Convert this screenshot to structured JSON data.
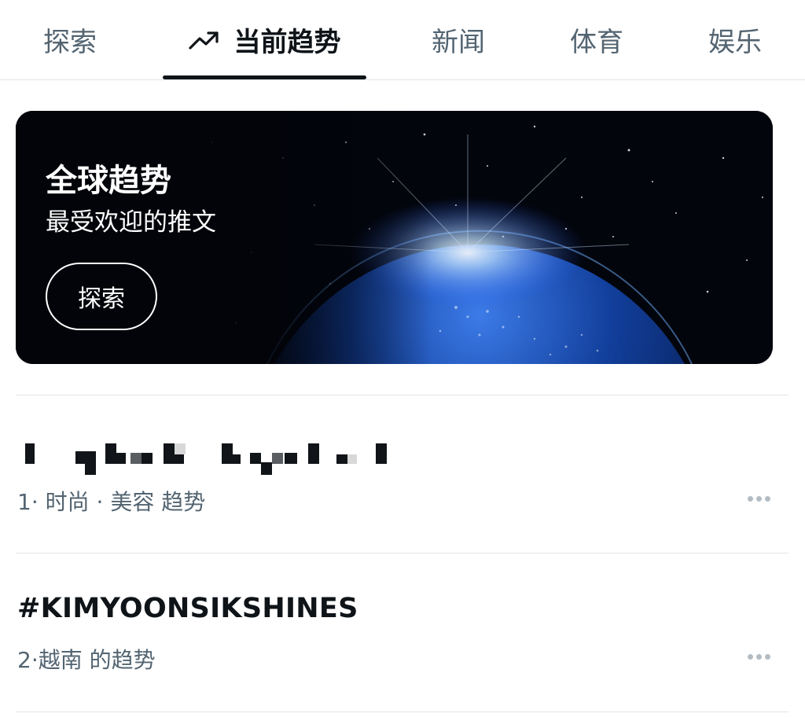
{
  "tabs": [
    {
      "label": "探索",
      "active": false
    },
    {
      "label": "当前趋势",
      "active": true,
      "icon": "trending-arrow-icon"
    },
    {
      "label": "新闻",
      "active": false
    },
    {
      "label": "体育",
      "active": false
    },
    {
      "label": "娱乐",
      "active": false
    }
  ],
  "banner": {
    "title": "全球趋势",
    "subtitle": "最受欢迎的推文",
    "button_label": "探索"
  },
  "trends": [
    {
      "rank": "1",
      "name_redacted": true,
      "meta": "1· 时尚 · 美容 趋势"
    },
    {
      "rank": "2",
      "name": "#KIMYOONSIKSHINES",
      "meta": "2·越南 的趋势"
    }
  ],
  "colors": {
    "text_primary": "#0f1419",
    "text_secondary": "#536471",
    "divider": "#e1e5e8",
    "more_dots": "#b4bcc3"
  }
}
